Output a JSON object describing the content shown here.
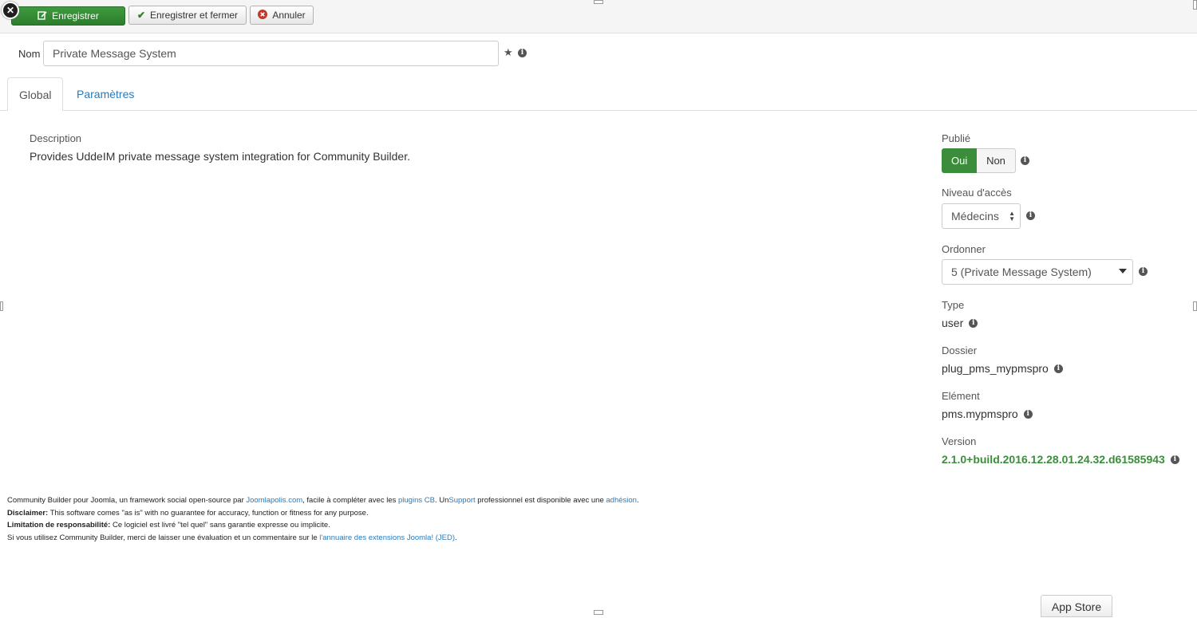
{
  "toolbar": {
    "save_label": "Enregistrer",
    "save_close_label": "Enregistrer et fermer",
    "cancel_label": "Annuler"
  },
  "name_field": {
    "label": "Nom",
    "value": "Private Message System"
  },
  "tabs": [
    {
      "label": "Global",
      "active": true
    },
    {
      "label": "Paramètres",
      "active": false
    }
  ],
  "description": {
    "label": "Description",
    "text": "Provides UddeIM private message system integration for Community Builder."
  },
  "sidebar": {
    "published": {
      "label": "Publié",
      "yes": "Oui",
      "no": "Non",
      "selected": "Oui"
    },
    "access": {
      "label": "Niveau d'accès",
      "value": "Médecins"
    },
    "ordering": {
      "label": "Ordonner",
      "value": "5 (Private Message System)"
    },
    "type": {
      "label": "Type",
      "value": "user"
    },
    "folder": {
      "label": "Dossier",
      "value": "plug_pms_mypmspro"
    },
    "element": {
      "label": "Elément",
      "value": "pms.mypmspro"
    },
    "version": {
      "label": "Version",
      "value": "2.1.0+build.2016.12.28.01.24.32.d61585943"
    }
  },
  "footer": {
    "line1_a": "Community Builder pour Joomla, un framework social open-source par ",
    "line1_link1": "Joomlapolis.com",
    "line1_b": ", facile à compléter avec les ",
    "line1_link2": "plugins CB",
    "line1_c": ". Un",
    "line1_link3": "Support",
    "line1_d": " professionnel est disponible avec une ",
    "line1_link4": "adhésion",
    "line1_e": ".",
    "line2_bold": "Disclaimer:",
    "line2_text": " This software comes \"as is\" with no guarantee for accuracy, function or fitness for any purpose.",
    "line3_bold": "Limitation de responsabilité:",
    "line3_text": " Ce logiciel est livré \"tel quel\" sans garantie expresse ou implicite.",
    "line4_text": "Si vous utilisez Community Builder, merci de laisser une évaluation et un commentaire sur le ",
    "line4_link": "l'annuaire des extensions Joomla! (JED)",
    "line4_end": "."
  },
  "app_store_label": "App Store",
  "colors": {
    "success": "#3b8d3b",
    "link": "#2a7ab9"
  },
  "icons": [
    "close-icon",
    "edit-icon",
    "check-icon",
    "cancel-circle-icon",
    "star-icon",
    "info-icon"
  ]
}
